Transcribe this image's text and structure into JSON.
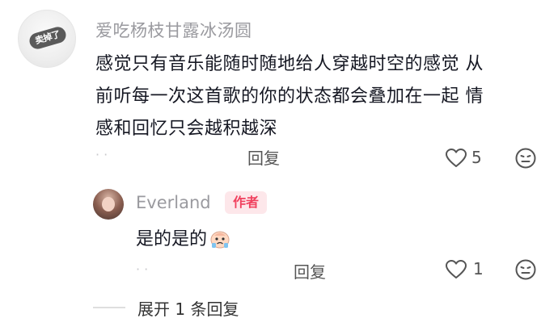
{
  "comment": {
    "sticker_label": "卖掉了",
    "author": "爱吃杨枝甘露冰汤圆",
    "text_lines": [
      "感觉只有音乐能随时随地给人穿越时空的感觉 从",
      "前听每一次这首歌的你的状态都会叠加在一起 情",
      "感和回忆只会越积越深"
    ],
    "timestamp": "·  ·",
    "reply_label": "回复",
    "like_count": "5"
  },
  "reply": {
    "author": "Everland",
    "author_badge": "作者",
    "text": "是的是的",
    "timestamp": "·  ·",
    "reply_label": "回复",
    "like_count": "1"
  },
  "expand_label": "展开 1 条回复",
  "icons": {
    "like": "heart-outline-icon",
    "dislike": "meh-face-icon",
    "emoji": "crying-face-emoji"
  },
  "colors": {
    "author_name": "#9a9a9f",
    "badge_bg": "#fde7ea",
    "badge_text": "#f0415e"
  }
}
